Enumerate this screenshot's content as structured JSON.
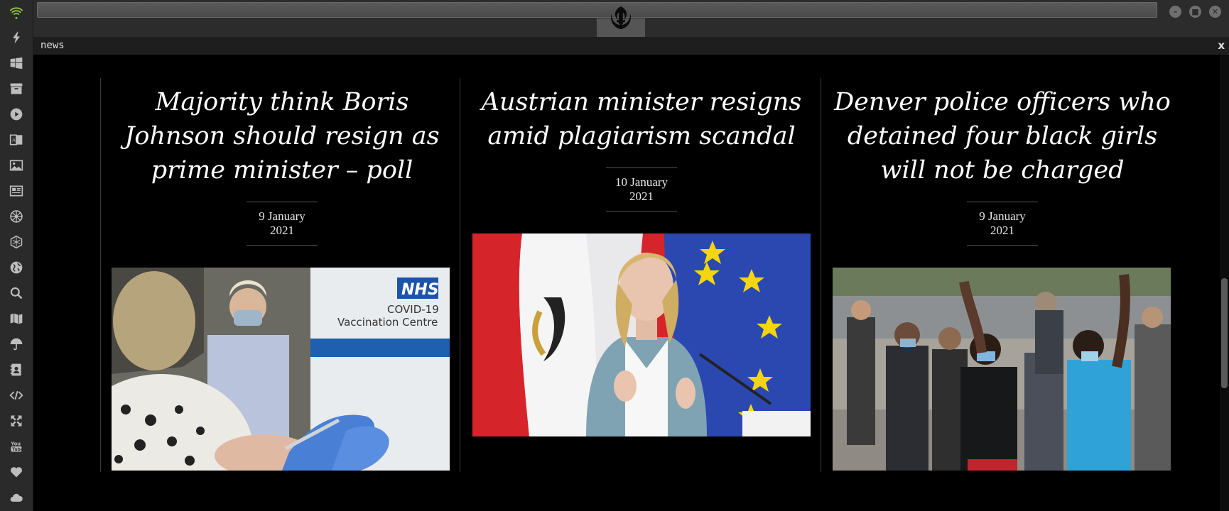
{
  "window": {
    "logo_icon": "rebel-alliance-icon",
    "controls": [
      {
        "name": "minimize-button",
        "glyph": "–"
      },
      {
        "name": "maximize-button",
        "glyph": "■"
      },
      {
        "name": "close-button",
        "glyph": "✕"
      }
    ]
  },
  "sidebar": {
    "items": [
      {
        "icon": "wifi-icon"
      },
      {
        "icon": "lightning-icon"
      },
      {
        "icon": "windows-icon"
      },
      {
        "icon": "archive-icon"
      },
      {
        "icon": "play-icon"
      },
      {
        "icon": "translate-icon"
      },
      {
        "icon": "image-icon"
      },
      {
        "icon": "newspaper-icon"
      },
      {
        "icon": "empire-icon"
      },
      {
        "icon": "hexagon-icon"
      },
      {
        "icon": "globe-icon"
      },
      {
        "icon": "search-icon"
      },
      {
        "icon": "map-icon"
      },
      {
        "icon": "umbrella-icon"
      },
      {
        "icon": "address-book-icon"
      },
      {
        "icon": "code-icon"
      },
      {
        "icon": "fullscreen-icon"
      },
      {
        "icon": "youtube-icon"
      },
      {
        "icon": "heart-icon"
      },
      {
        "icon": "cloud-icon"
      }
    ],
    "accent_color": "#8bc34a"
  },
  "panel": {
    "title": "news",
    "close_label": "x"
  },
  "articles": [
    {
      "headline": "Majority think Boris Johnson should resign as prime minister – poll",
      "date": "9 January 2021",
      "image": "vaccination-photo"
    },
    {
      "headline": "Austrian minister resigns amid plagiarism scandal",
      "date": "10 January 2021",
      "image": "minister-photo"
    },
    {
      "headline": "Denver police officers who detained four black girls will not be charged",
      "date": "9 January 2021",
      "image": "protest-photo"
    }
  ]
}
